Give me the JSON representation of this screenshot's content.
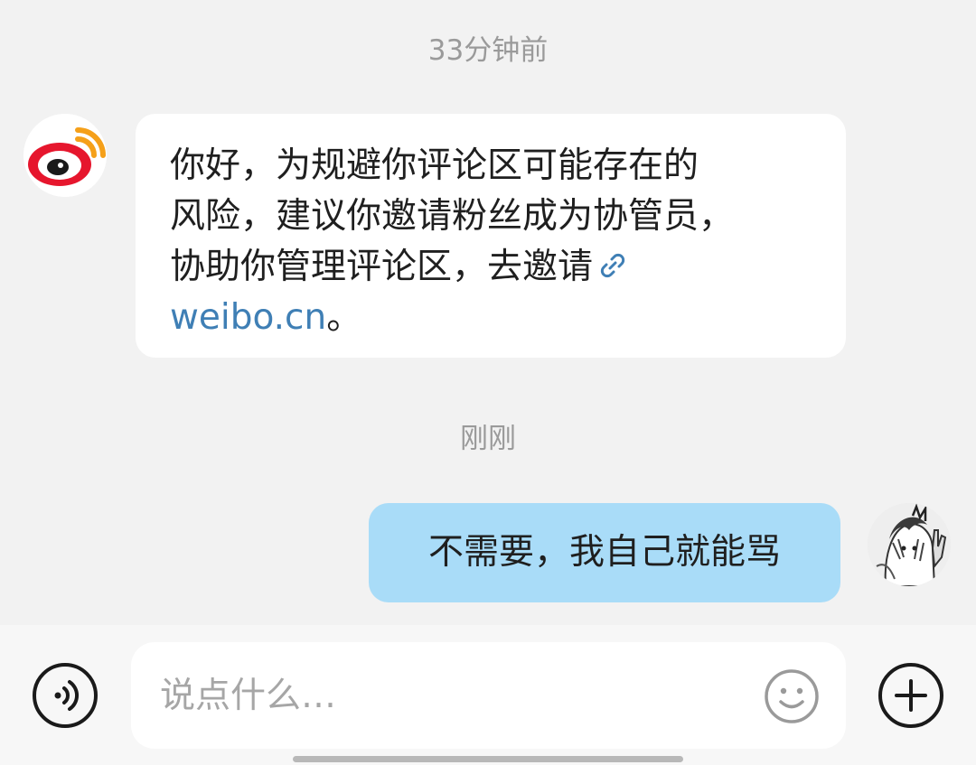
{
  "conversation": {
    "timestamp_1": "33分钟前",
    "timestamp_2": "刚刚",
    "incoming": {
      "sender_icon": "weibo-logo-icon",
      "lines": [
        "你好，为规避你评论区可能存在的",
        "风险，建议你邀请粉丝成为协管员，",
        "协助你管理评论区，去邀请"
      ],
      "link_icon": "link-icon",
      "link_text": "weibo.cn",
      "link_suffix": "。",
      "link_color": "#3f7fb5"
    },
    "outgoing": {
      "text": "不需要，我自己就能骂",
      "bubble_color": "#a9dcf8",
      "avatar_icon": "user-avatar-icon"
    }
  },
  "input_bar": {
    "voice_icon": "voice-icon",
    "placeholder": "说点什么…",
    "emoji_icon": "emoji-icon",
    "plus_icon": "plus-icon"
  },
  "colors": {
    "background": "#f2f2f2",
    "timestamp": "#9a9a9a",
    "weibo_red": "#e6162d",
    "weibo_orange": "#f5a01a"
  }
}
